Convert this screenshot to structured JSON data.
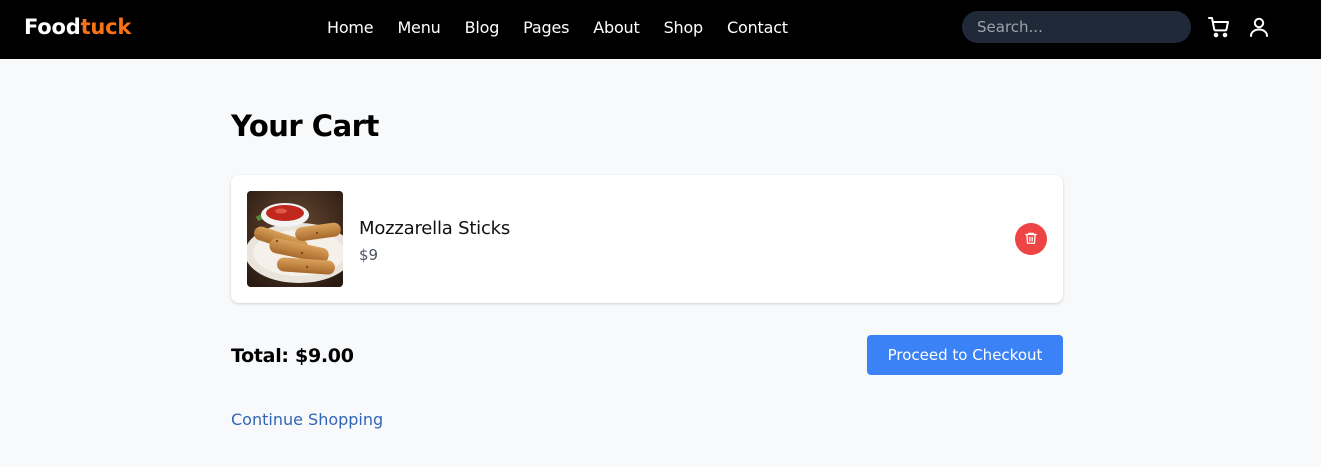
{
  "brand": {
    "part1": "Food",
    "part2": "tuck",
    "accent_color": "#f97316"
  },
  "nav": {
    "links": [
      {
        "label": "Home"
      },
      {
        "label": "Menu"
      },
      {
        "label": "Blog"
      },
      {
        "label": "Pages"
      },
      {
        "label": "About"
      },
      {
        "label": "Shop"
      },
      {
        "label": "Contact"
      }
    ],
    "search": {
      "placeholder": "Search...",
      "value": ""
    },
    "icons": [
      "cart-icon",
      "user-icon"
    ]
  },
  "cart": {
    "title": "Your Cart",
    "items": [
      {
        "name": "Mozzarella Sticks",
        "price": "$9",
        "image": "mozzarella-sticks-photo",
        "action_icon": "trash-icon"
      }
    ],
    "total_label": "Total: $9.00",
    "checkout_label": "Proceed to Checkout",
    "continue_label": "Continue Shopping"
  },
  "colors": {
    "navbar_bg": "#000000",
    "page_bg": "#f8f9fb",
    "primary": "#3b82f6",
    "danger": "#ef4444",
    "link": "#3165b8"
  }
}
